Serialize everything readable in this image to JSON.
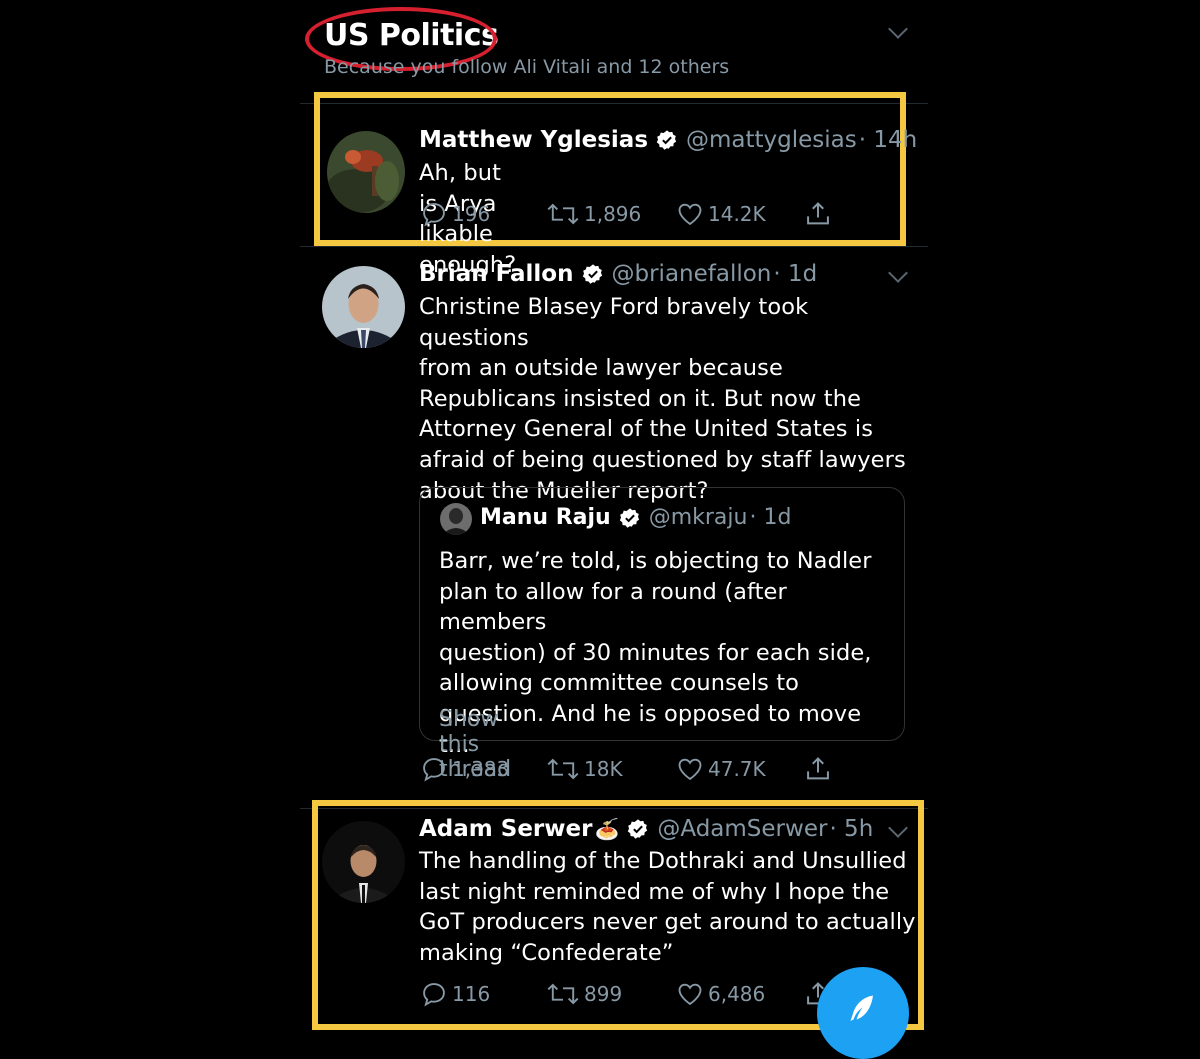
{
  "header": {
    "title": "US Politics",
    "subtitle": "Because you follow Ali Vitali and 12 others"
  },
  "tweets": [
    {
      "name": "Matthew Yglesias",
      "handle": "@mattyglesias",
      "time": "· 14h",
      "text": "Ah, but is Arya likable enough?",
      "replies": "196",
      "retweets": "1,896",
      "likes": "14.2K"
    },
    {
      "name": "Brian Fallon",
      "handle": "@brianefallon",
      "time": "· 1d",
      "text_lines": [
        "Christine Blasey Ford bravely took questions",
        "from an outside lawyer because",
        "Republicans insisted on it. But now the",
        "Attorney General of the United States is",
        "afraid of being questioned by staff lawyers",
        "about the Mueller report?"
      ],
      "quote": {
        "name": "Manu Raju",
        "handle": "@mkraju",
        "time": "· 1d",
        "text_lines": [
          "Barr, we’re told, is objecting to Nadler",
          "plan to allow for a round (after members",
          "question) of 30 minutes for each side,",
          "allowing committee counsels to",
          "question. And he is opposed to move t..."
        ],
        "show_thread": "Show this thread"
      },
      "replies": "1,383",
      "retweets": "18K",
      "likes": "47.7K"
    },
    {
      "name": "Adam Serwer",
      "name_emoji": "🍝",
      "handle": "@AdamSerwer",
      "time": "· 5h",
      "text_lines": [
        "The handling of the Dothraki and Unsullied",
        "last night reminded me of why I hope the",
        "GoT producers never get around to actually",
        "making “Confederate”"
      ],
      "replies": "116",
      "retweets": "899",
      "likes": "6,486"
    }
  ],
  "colors": {
    "background": "#000000",
    "secondary_text": "#8899a6",
    "verified_blue": "#1da1f2",
    "highlight_yellow": "#f5c842",
    "annotation_red": "#d6202f"
  }
}
